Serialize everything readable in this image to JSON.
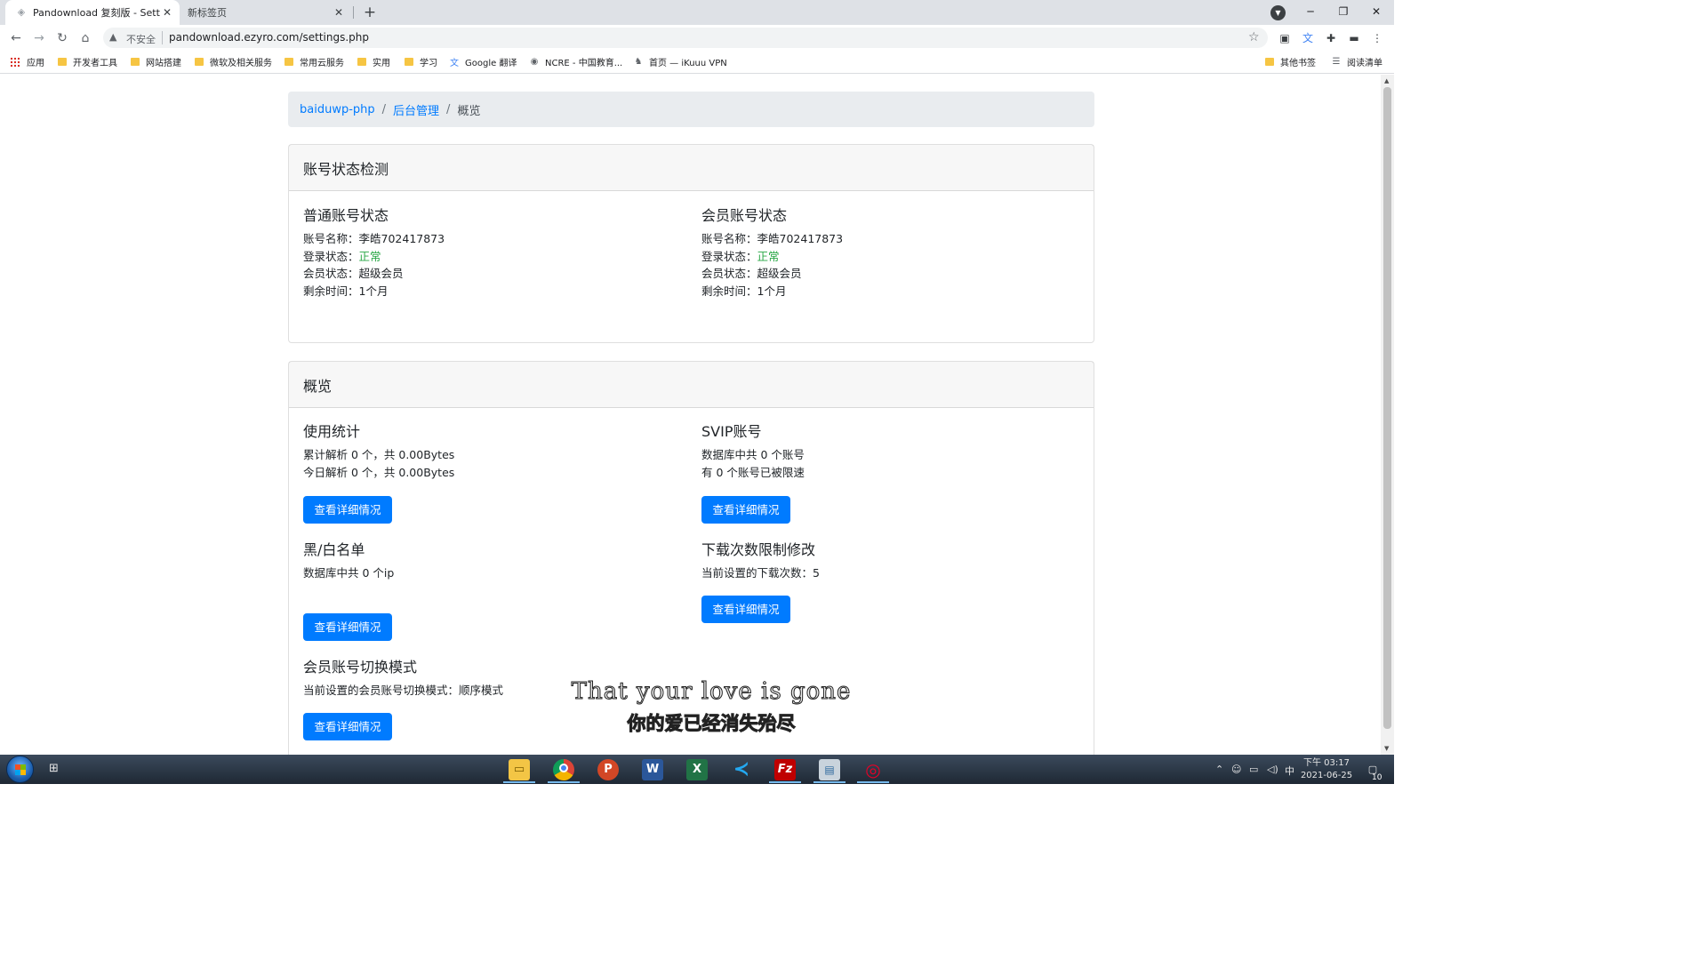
{
  "browser": {
    "tabs": [
      {
        "title": "Pandownload 复刻版 - Settings",
        "active": true
      },
      {
        "title": "新标签页",
        "active": false
      }
    ],
    "security_label": "不安全",
    "url": "pandownload.ezyro.com/settings.php",
    "bookmarks": [
      {
        "label": "应用",
        "icon": "apps-grid-icon"
      },
      {
        "label": "开发者工具",
        "icon": "folder-icon"
      },
      {
        "label": "网站搭建",
        "icon": "folder-icon"
      },
      {
        "label": "微软及相关服务",
        "icon": "folder-icon"
      },
      {
        "label": "常用云服务",
        "icon": "folder-icon"
      },
      {
        "label": "实用",
        "icon": "folder-icon"
      },
      {
        "label": "学习",
        "icon": "folder-icon"
      },
      {
        "label": "Google 翻译",
        "icon": "google-translate-icon"
      },
      {
        "label": "NCRE - 中国教育...",
        "icon": "globe-icon"
      },
      {
        "label": "首页 — iKuuu VPN",
        "icon": "cat-icon"
      }
    ],
    "bookmarks_right": [
      {
        "label": "其他书签",
        "icon": "folder-icon"
      },
      {
        "label": "阅读清单",
        "icon": "reading-list-icon"
      }
    ]
  },
  "breadcrumb": {
    "items": [
      "baiduwp-php",
      "后台管理"
    ],
    "current": "概览",
    "separator": "/"
  },
  "account_card": {
    "header": "账号状态检测",
    "normal": {
      "title": "普通账号状态",
      "name_label": "账号名称：",
      "name": "李皓702417873",
      "login_label": "登录状态：",
      "login": "正常",
      "vip_label": "会员状态：",
      "vip": "超级会员",
      "remain_label": "剩余时间：",
      "remain": "1个月"
    },
    "member": {
      "title": "会员账号状态",
      "name_label": "账号名称：",
      "name": "李皓702417873",
      "login_label": "登录状态：",
      "login": "正常",
      "vip_label": "会员状态：",
      "vip": "超级会员",
      "remain_label": "剩余时间：",
      "remain": "1个月"
    }
  },
  "overview_card": {
    "header": "概览",
    "usage": {
      "title": "使用统计",
      "line1": "累计解析 0 个，共 0.00Bytes",
      "line2": "今日解析 0 个，共 0.00Bytes",
      "button": "查看详细情况"
    },
    "svip": {
      "title": "SVIP账号",
      "line1": "数据库中共 0 个账号",
      "line2": "有 0 个账号已被限速",
      "button": "查看详细情况"
    },
    "blacklist": {
      "title": "黑/白名单",
      "line1": "数据库中共 0 个ip",
      "button": "查看详细情况"
    },
    "download_limit": {
      "title": "下载次数限制修改",
      "line1": "当前设置的下载次数：5",
      "button": "查看详细情况"
    },
    "switch_mode": {
      "title": "会员账号切换模式",
      "line1": "当前设置的会员账号切换模式：顺序模式",
      "button": "查看详细情况"
    }
  },
  "subtitle": {
    "en": "That your love is gone",
    "zh": "你的爱已经消失殆尽"
  },
  "taskbar": {
    "apps": [
      "file-explorer-icon",
      "chrome-icon",
      "powerpoint-icon",
      "word-icon",
      "excel-icon",
      "vscode-icon",
      "filezilla-icon",
      "task-manager-icon",
      "netease-music-icon"
    ],
    "ime": "中",
    "time": "下午 03:17",
    "date": "2021-06-25",
    "notification_count": "10"
  },
  "colors": {
    "link": "#007bff",
    "button": "#007bff",
    "success": "#28a745",
    "breadcrumb_bg": "#e9ecef"
  }
}
